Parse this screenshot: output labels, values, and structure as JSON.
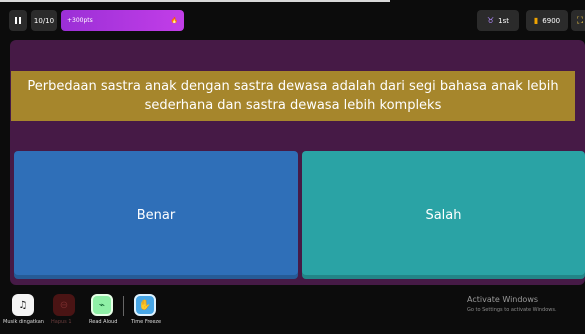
{
  "topbar": {
    "question_counter": "10/10",
    "streak_label": "+300pts",
    "streak_icon_text": "🔥",
    "rank": "1st",
    "score": "6900"
  },
  "question": {
    "text": "Perbedaan sastra anak dengan sastra dewasa adalah dari segi bahasa anak lebih sederhana dan sastra dewasa lebih kompleks"
  },
  "answers": [
    {
      "label": "Benar",
      "color": "#2f6fb8"
    },
    {
      "label": "Salah",
      "color": "#2aa3a5"
    }
  ],
  "powerups": [
    {
      "label": "Musik dingatkan",
      "icon": "music-note-icon"
    },
    {
      "label": "Hapus 1",
      "icon": "eliminate-icon"
    },
    {
      "label": "Read Aloud",
      "icon": "read-aloud-icon"
    },
    {
      "label": "Time Freeze",
      "icon": "time-freeze-icon"
    }
  ],
  "watermark": {
    "title": "Activate Windows",
    "subtitle": "Go to Settings to activate Windows."
  },
  "colors": {
    "panel": "#461a46",
    "question_bg": "#a6862c",
    "streak": "#b63be2"
  }
}
